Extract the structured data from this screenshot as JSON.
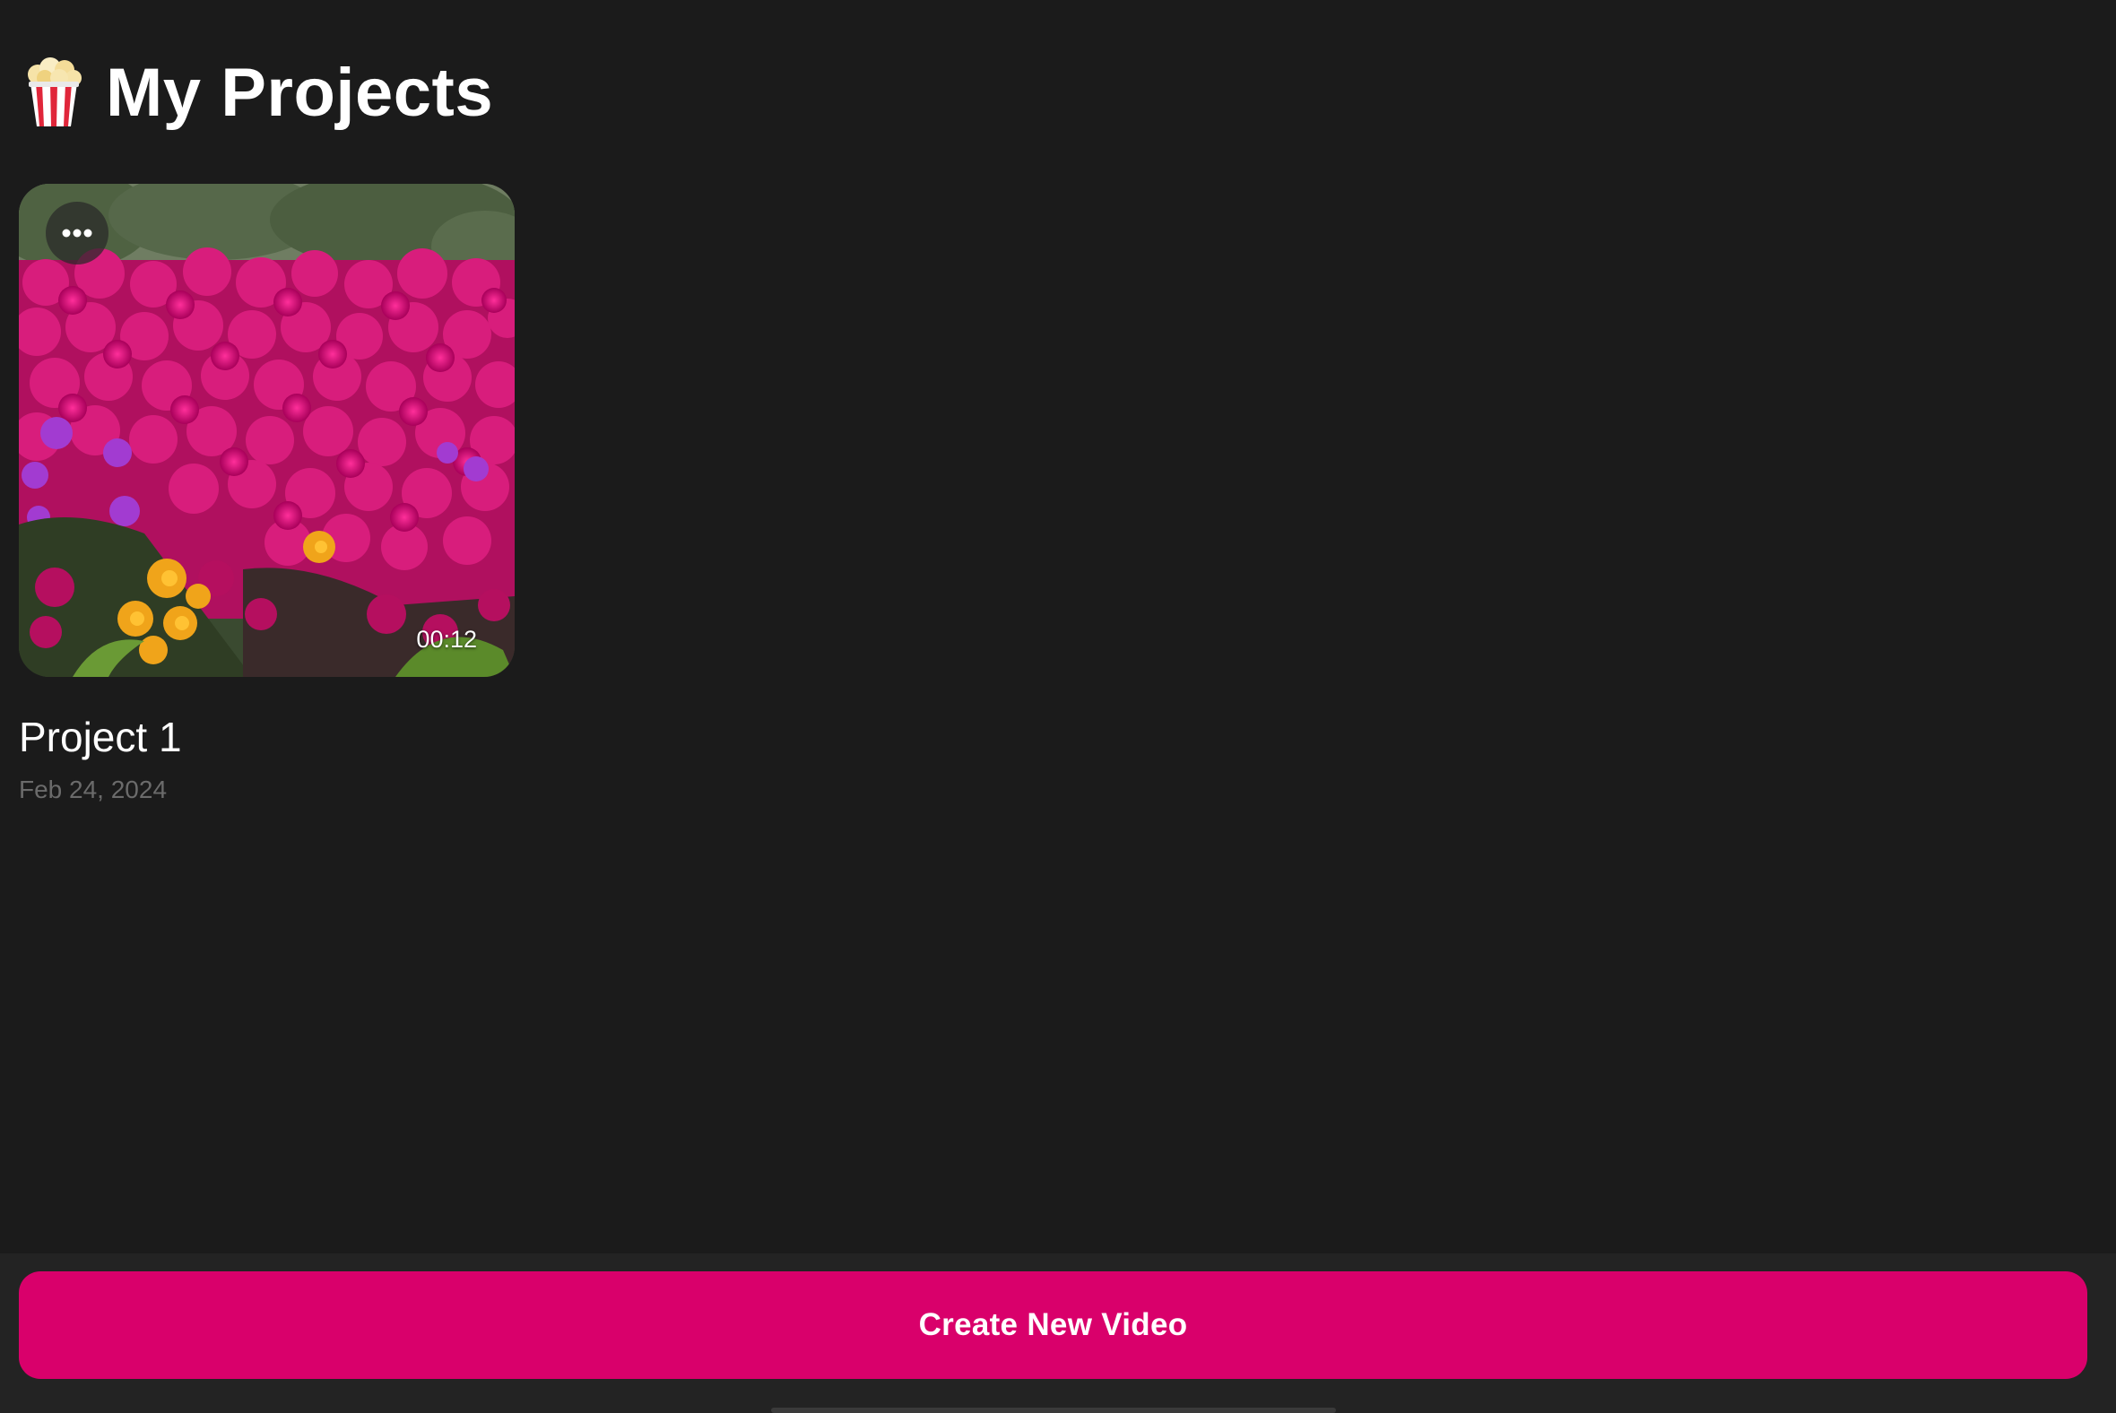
{
  "header": {
    "icon": "popcorn-icon",
    "title": "My Projects"
  },
  "projects": [
    {
      "name": "Project 1",
      "date": "Feb 24, 2024",
      "duration": "00:12",
      "thumbnail": "flower-field",
      "more_icon": "ellipsis-icon"
    }
  ],
  "footer": {
    "create_button_label": "Create New Video"
  },
  "colors": {
    "background": "#1b1b1b",
    "accent": "#d9006b",
    "date_text": "#6b6b6b"
  }
}
